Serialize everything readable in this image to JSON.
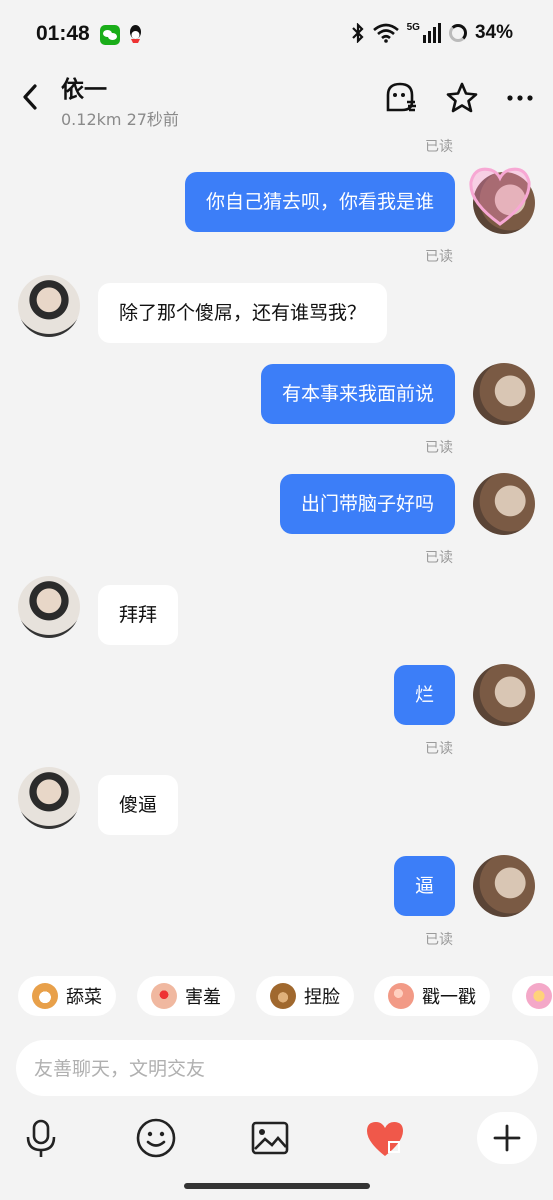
{
  "status_bar": {
    "time": "01:48",
    "network": "5G",
    "battery": "34%"
  },
  "header": {
    "title": "依一",
    "subtitle": "0.12km  27秒前"
  },
  "read_label": "已读",
  "messages": [
    {
      "from": "me",
      "text": "你自己猜去呗，你看我是谁"
    },
    {
      "from": "them",
      "text": "除了那个傻屌，还有谁骂我？"
    },
    {
      "from": "me",
      "text": "有本事来我面前说"
    },
    {
      "from": "me",
      "text": "出门带脑子好吗"
    },
    {
      "from": "them",
      "text": "拜拜"
    },
    {
      "from": "me",
      "text": "烂"
    },
    {
      "from": "them",
      "text": "傻逼"
    },
    {
      "from": "me",
      "text": "逼"
    }
  ],
  "quick_actions": [
    {
      "label": "舔菜",
      "icon": "corgi-icon",
      "color": "#e8a04a"
    },
    {
      "label": "害羞",
      "icon": "shy-hands-icon",
      "color": "#f0b8a0"
    },
    {
      "label": "捏脸",
      "icon": "bear-icon",
      "color": "#a0682e"
    },
    {
      "label": "戳一戳",
      "icon": "peach-icon",
      "color": "#f29a86"
    }
  ],
  "input": {
    "placeholder": "友善聊天，文明交友"
  },
  "colors": {
    "accent": "#3c7ef8",
    "heart": "#f0584a"
  }
}
